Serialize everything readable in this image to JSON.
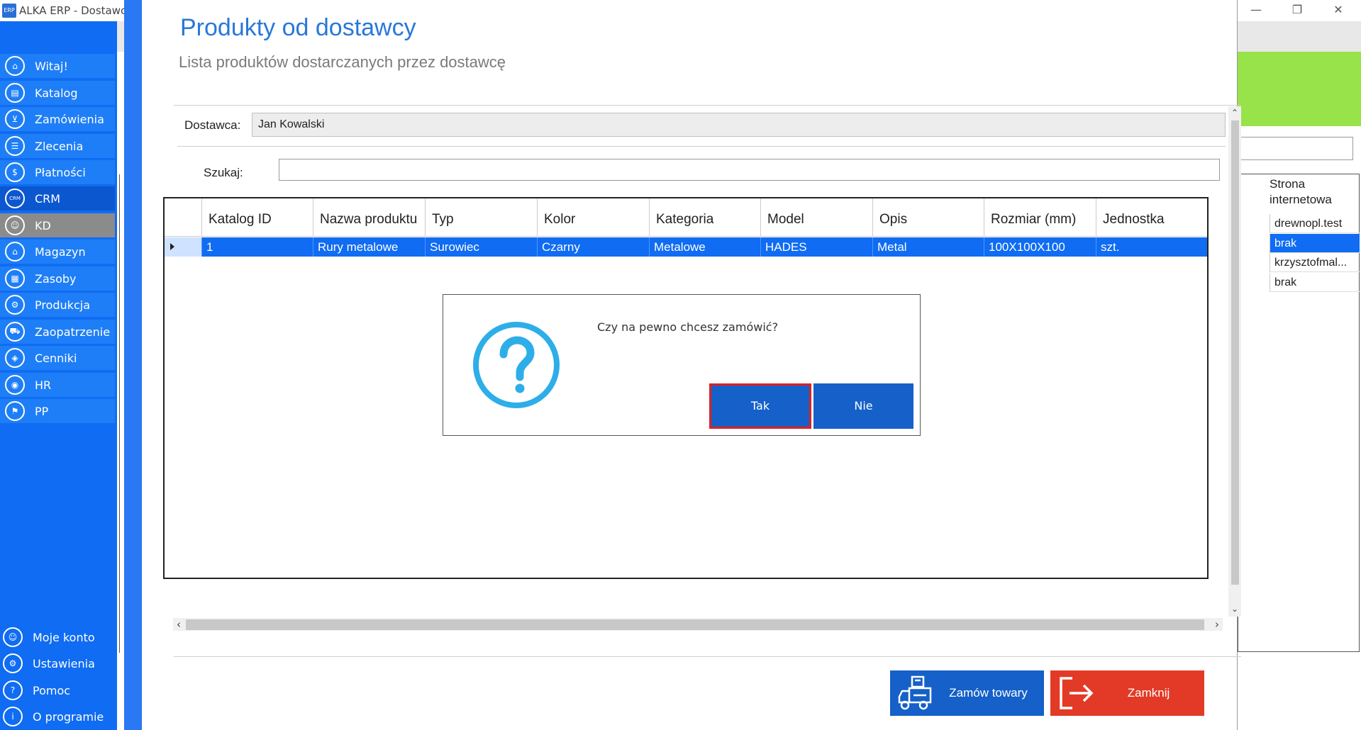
{
  "window": {
    "title": "ALKA ERP - Dostawcy",
    "logo_text": "ERP",
    "minimize": "—",
    "restore": "❐",
    "close": "✕"
  },
  "sidebar": {
    "items": [
      {
        "label": "Witaj!",
        "icon": "home-icon",
        "glyph": "⌂"
      },
      {
        "label": "Katalog",
        "icon": "book-icon",
        "glyph": "▤"
      },
      {
        "label": "Zamówienia",
        "icon": "cart-icon",
        "glyph": "⊻"
      },
      {
        "label": "Zlecenia",
        "icon": "list-icon",
        "glyph": "☰"
      },
      {
        "label": "Płatności",
        "icon": "dollar-icon",
        "glyph": "$"
      },
      {
        "label": "CRM",
        "icon": "crm-icon",
        "glyph": "CRM"
      },
      {
        "label": "KD",
        "icon": "user-icon",
        "glyph": "☺"
      },
      {
        "label": "Magazyn",
        "icon": "warehouse-icon",
        "glyph": "⌂"
      },
      {
        "label": "Zasoby",
        "icon": "resources-icon",
        "glyph": "▦"
      },
      {
        "label": "Produkcja",
        "icon": "production-icon",
        "glyph": "⚙"
      },
      {
        "label": "Zaopatrzenie",
        "icon": "truck-icon",
        "glyph": "⛟"
      },
      {
        "label": "Cenniki",
        "icon": "tag-icon",
        "glyph": "◈"
      },
      {
        "label": "HR",
        "icon": "hr-icon",
        "glyph": "◉"
      },
      {
        "label": "PP",
        "icon": "pp-icon",
        "glyph": "⚑"
      }
    ],
    "bottom_items": [
      {
        "label": "Moje konto",
        "icon": "account-icon",
        "glyph": "☺"
      },
      {
        "label": "Ustawienia",
        "icon": "settings-icon",
        "glyph": "⚙"
      },
      {
        "label": "Pomoc",
        "icon": "help-icon",
        "glyph": "?"
      },
      {
        "label": "O programie",
        "icon": "info-icon",
        "glyph": "i"
      }
    ]
  },
  "background": {
    "column_header": "Strona internetowa",
    "cells": [
      "drewnopl.test",
      "brak",
      "krzysztofmal...",
      "brak"
    ]
  },
  "dialog": {
    "title": "Produkty od dostawcy",
    "subtitle": "Lista produktów dostarczanych przez dostawcę",
    "supplier_label": "Dostawca:",
    "supplier_value": "Jan Kowalski",
    "search_label": "Szukaj:",
    "search_value": "",
    "columns": [
      "Katalog ID",
      "Nazwa produktu",
      "Typ",
      "Kolor",
      "Kategoria",
      "Model",
      "Opis",
      "Rozmiar (mm)",
      "Jednostka"
    ],
    "rows": [
      [
        "1",
        "Rury metalowe",
        "Surowiec",
        "Czarny",
        "Metalowe",
        "HADES",
        "Metal",
        "100X100X100",
        "szt."
      ]
    ],
    "order_button": "Zamów towary",
    "close_button": "Zamknij"
  },
  "msgbox": {
    "text": "Czy na pewno chcesz zamówić?",
    "yes": "Tak",
    "no": "Nie"
  },
  "colors": {
    "sidebar": "#0f6cf3",
    "accent": "#2878d8",
    "primary_button": "#1560c9",
    "danger_button": "#e23a26",
    "selection": "#0f6cf3",
    "focus_border": "#e02020"
  }
}
